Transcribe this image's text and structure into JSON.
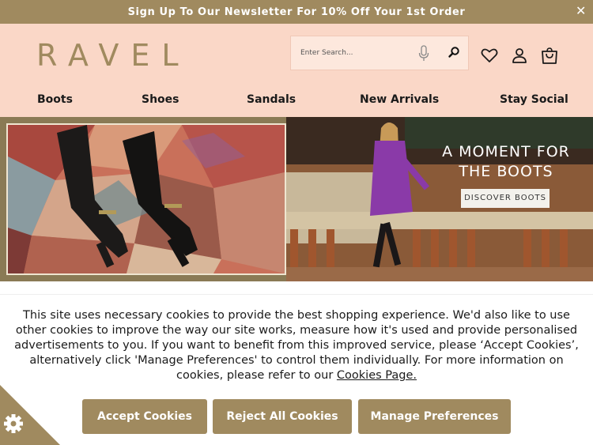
{
  "promo": {
    "text": "Sign Up To Our Newsletter For 10% Off Your 1st Order",
    "close_glyph": "✕"
  },
  "header": {
    "logo": "RAVEL",
    "search_placeholder": "Enter Search..."
  },
  "nav": {
    "items": [
      "Boots",
      "Shoes",
      "Sandals",
      "New Arrivals",
      "Stay Social"
    ]
  },
  "hero": {
    "title": "A MOMENT FOR THE BOOTS",
    "cta": "DISCOVER BOOTS"
  },
  "cookies": {
    "message": "This site uses necessary cookies to provide the best shopping experience. We'd also like to use other cookies to improve the way our site works, measure how it's used and provide personalised advertisements to you. If you want to benefit from this improved service, please ‘Accept Cookies’, alternatively click 'Manage Preferences' to control them individually. For more information on cookies, please refer to our",
    "link_text": "Cookies Page.",
    "accept_label": "Accept Cookies",
    "reject_label": "Reject All Cookies",
    "manage_label": "Manage Preferences"
  },
  "colors": {
    "brand": "#a08a5f",
    "header_bg": "#fad7c7",
    "text": "#1a1a1a"
  },
  "icons": [
    "close-icon",
    "microphone-icon",
    "search-icon",
    "heart-icon",
    "account-icon",
    "shopping-bag-icon",
    "gear-icon"
  ]
}
